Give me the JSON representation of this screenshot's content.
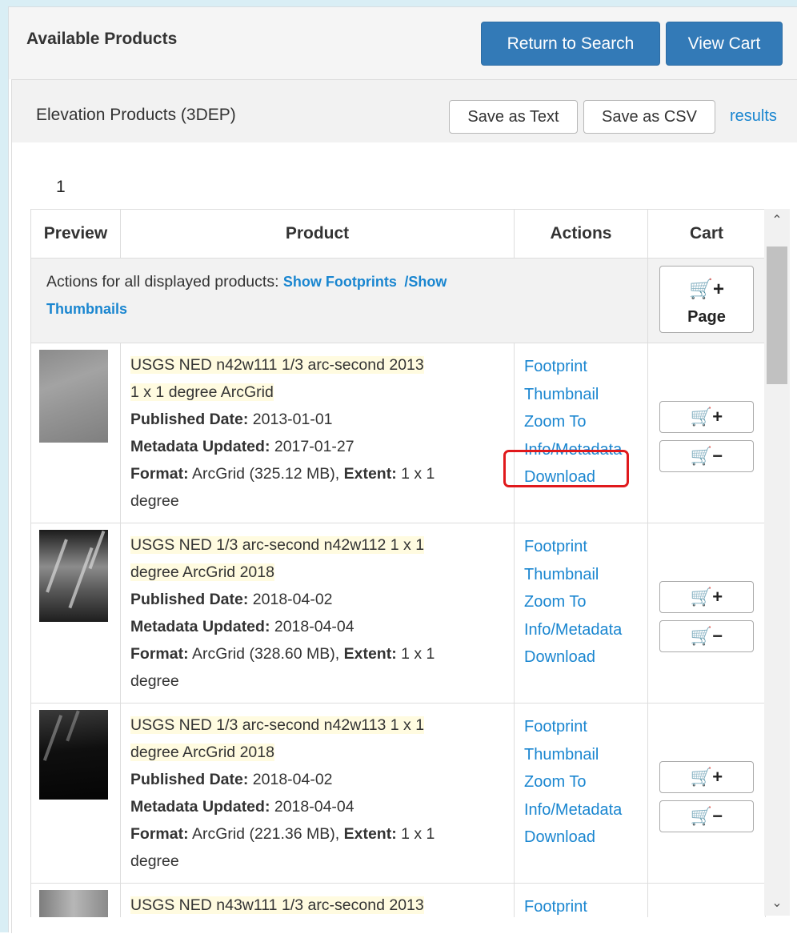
{
  "header": {
    "title": "Available Products",
    "return_button": "Return to Search",
    "cart_button": "View Cart"
  },
  "section": {
    "title": "Elevation Products (3DEP)",
    "save_text": "Save as Text",
    "save_csv": "Save as CSV",
    "results_link": "results",
    "page_number": "1"
  },
  "table": {
    "columns": [
      "Preview",
      "Product",
      "Actions",
      "Cart"
    ],
    "bulk_label": "Actions for all displayed products:",
    "show_footprints": "Show Footprints",
    "separator": "/",
    "show_thumbnails_a": "Show",
    "show_thumbnails_b": "Thumbnails",
    "page_button_label": "Page"
  },
  "labels": {
    "published": "Published Date:",
    "metadata_updated": "Metadata Updated:",
    "format": "Format:",
    "extent": "Extent:"
  },
  "action_links": [
    "Footprint",
    "Thumbnail",
    "Zoom To",
    "Info/Metadata",
    "Download"
  ],
  "products": [
    {
      "title_a": "USGS NED n42w111 1/3 arc-second 2013",
      "title_b": "1 x 1 degree ArcGrid",
      "published": "2013-01-01",
      "metadata_updated": "2017-01-27",
      "format": "ArcGrid (325.12 MB),",
      "extent_a": "1 x 1",
      "extent_b": "degree"
    },
    {
      "title_a": "USGS NED 1/3 arc-second n42w112 1 x 1",
      "title_b": "degree ArcGrid 2018",
      "published": "2018-04-02",
      "metadata_updated": "2018-04-04",
      "format": "ArcGrid (328.60 MB),",
      "extent_a": "1 x 1",
      "extent_b": "degree"
    },
    {
      "title_a": "USGS NED 1/3 arc-second n42w113 1 x 1",
      "title_b": "degree ArcGrid 2018",
      "published": "2018-04-02",
      "metadata_updated": "2018-04-04",
      "format": "ArcGrid (221.36 MB),",
      "extent_a": "1 x 1",
      "extent_b": "degree"
    },
    {
      "title_a": "USGS NED n43w111 1/3 arc-second 2013"
    }
  ],
  "icons": {
    "cart": "cart-icon",
    "plus": "plus-icon",
    "minus": "minus-icon",
    "chevron_up": "chevron-up-icon",
    "chevron_down": "chevron-down-icon"
  },
  "colors": {
    "primary": "#337ab7",
    "link": "#1a86d0",
    "highlight": "#fffbe0",
    "annotation_red": "#e0191c"
  }
}
